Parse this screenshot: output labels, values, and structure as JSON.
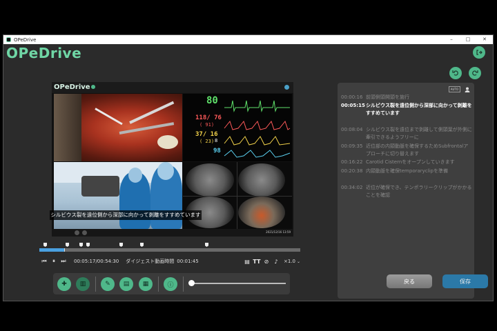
{
  "window": {
    "title": "OPeDrive"
  },
  "titlebar_controls": [
    "–",
    "□",
    "✕"
  ],
  "app": {
    "logo": "OPeDrive"
  },
  "header_buttons": {
    "logout_icon": "logout-icon",
    "undo_icon": "undo-icon",
    "redo_icon": "redo-icon"
  },
  "video": {
    "logo": "OPeDrive",
    "subtitle": "シルビウス裂を遠位側から深部に向かって剥離をすすめています",
    "timestamp": "2021/12/16 13:59",
    "vitals": {
      "hr": "80",
      "bp": "118/ 76",
      "bp_mean": "( 91)",
      "pa": "37/ 16",
      "pa_mean": "( 23)",
      "spo2": "98",
      "misc": "8"
    }
  },
  "timeline": {
    "progress": 0.095
  },
  "player": {
    "play_icon": "play-icon",
    "time": "00:05:17/00:54:30",
    "digest_label": "ダイジェスト動画時間",
    "digest_time": "00:01:45",
    "speed": "×1.0"
  },
  "transcript": {
    "badge": "AUTO",
    "lines": [
      {
        "time": "00:00:16",
        "text": "前頭側頭開頭を施行"
      },
      {
        "time": "00:05:15",
        "text": "シルビウス裂を遠位側から深部に向かって剥離をすすめています"
      },
      {
        "time": "00:08:04",
        "text": "シルビウス裂を遠位まで剥離して側頭葉が外側に牽引できるようフリーに"
      },
      {
        "time": "00:09:35",
        "text": "近位部の内頸動脈を確保するためSubfrontalアプローチに切り替えます"
      },
      {
        "time": "00:16:22",
        "text": "Carotid Cisternをオープンしていきます"
      },
      {
        "time": "00:20:38",
        "text": "内頸動脈を確保temporaryclipを準備"
      },
      {
        "time": "00:34:02",
        "text": "近位が確保でき、テンポラリークリップがかかることを確認"
      }
    ]
  },
  "actions": {
    "back": "戻る",
    "save": "保存"
  },
  "colors": {
    "accent": "#4fb88a",
    "save": "#2b79a8",
    "timeline_fill": "#4aa0e0"
  }
}
